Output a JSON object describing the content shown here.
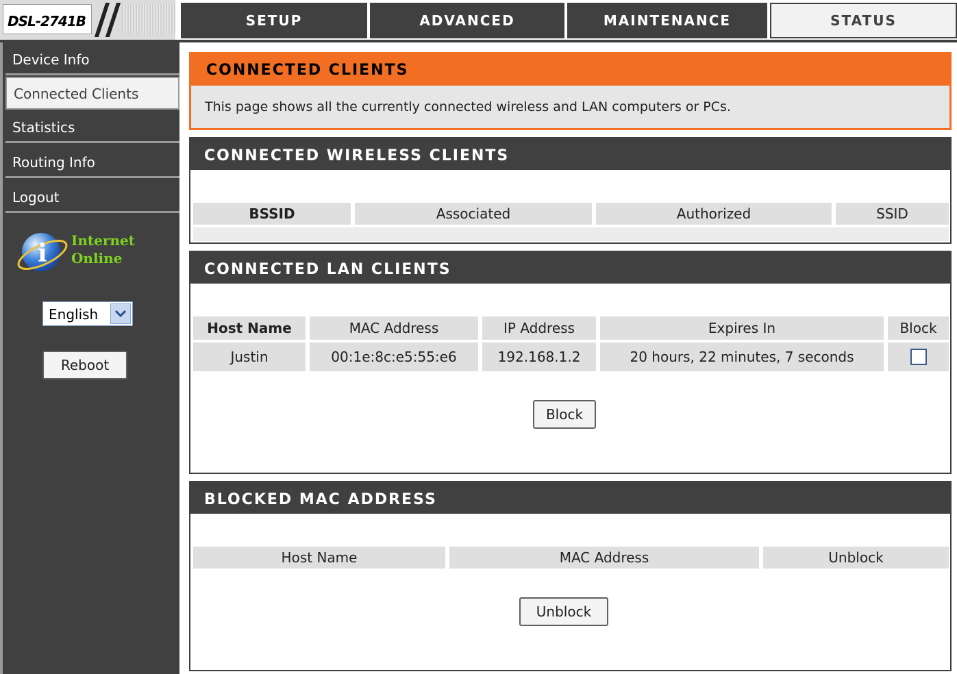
{
  "header": {
    "logo_text": "DSL-2741B",
    "tabs": [
      {
        "label": "SETUP"
      },
      {
        "label": "ADVANCED"
      },
      {
        "label": "MAINTENANCE"
      },
      {
        "label": "STATUS",
        "active": true
      }
    ]
  },
  "sidebar": {
    "items": [
      {
        "label": "Device Info"
      },
      {
        "label": "Connected Clients",
        "active": true
      },
      {
        "label": "Statistics"
      },
      {
        "label": "Routing Info"
      },
      {
        "label": "Logout"
      }
    ],
    "status_line1": "Internet",
    "status_line2": "Online",
    "language": "English",
    "reboot_label": "Reboot"
  },
  "intro": {
    "title": "CONNECTED CLIENTS",
    "description": "This page shows all the currently connected wireless and LAN computers or PCs."
  },
  "wireless": {
    "title": "CONNECTED WIRELESS CLIENTS",
    "columns": [
      "BSSID",
      "Associated",
      "Authorized",
      "SSID"
    ]
  },
  "lan": {
    "title": "CONNECTED LAN CLIENTS",
    "columns": [
      "Host Name",
      "MAC Address",
      "IP Address",
      "Expires In",
      "Block"
    ],
    "rows": [
      {
        "host": "Justin",
        "mac": "00:1e:8c:e5:55:e6",
        "ip": "192.168.1.2",
        "expires": "20 hours, 22 minutes, 7 seconds",
        "blocked": false
      }
    ],
    "block_button": "Block"
  },
  "blocked": {
    "title": "BLOCKED MAC ADDRESS",
    "columns": [
      "Host Name",
      "MAC Address",
      "Unblock"
    ],
    "unblock_button": "Unblock"
  },
  "colors": {
    "accent": "#f26e22",
    "dark": "#404040",
    "status_green": "#7ed321"
  }
}
